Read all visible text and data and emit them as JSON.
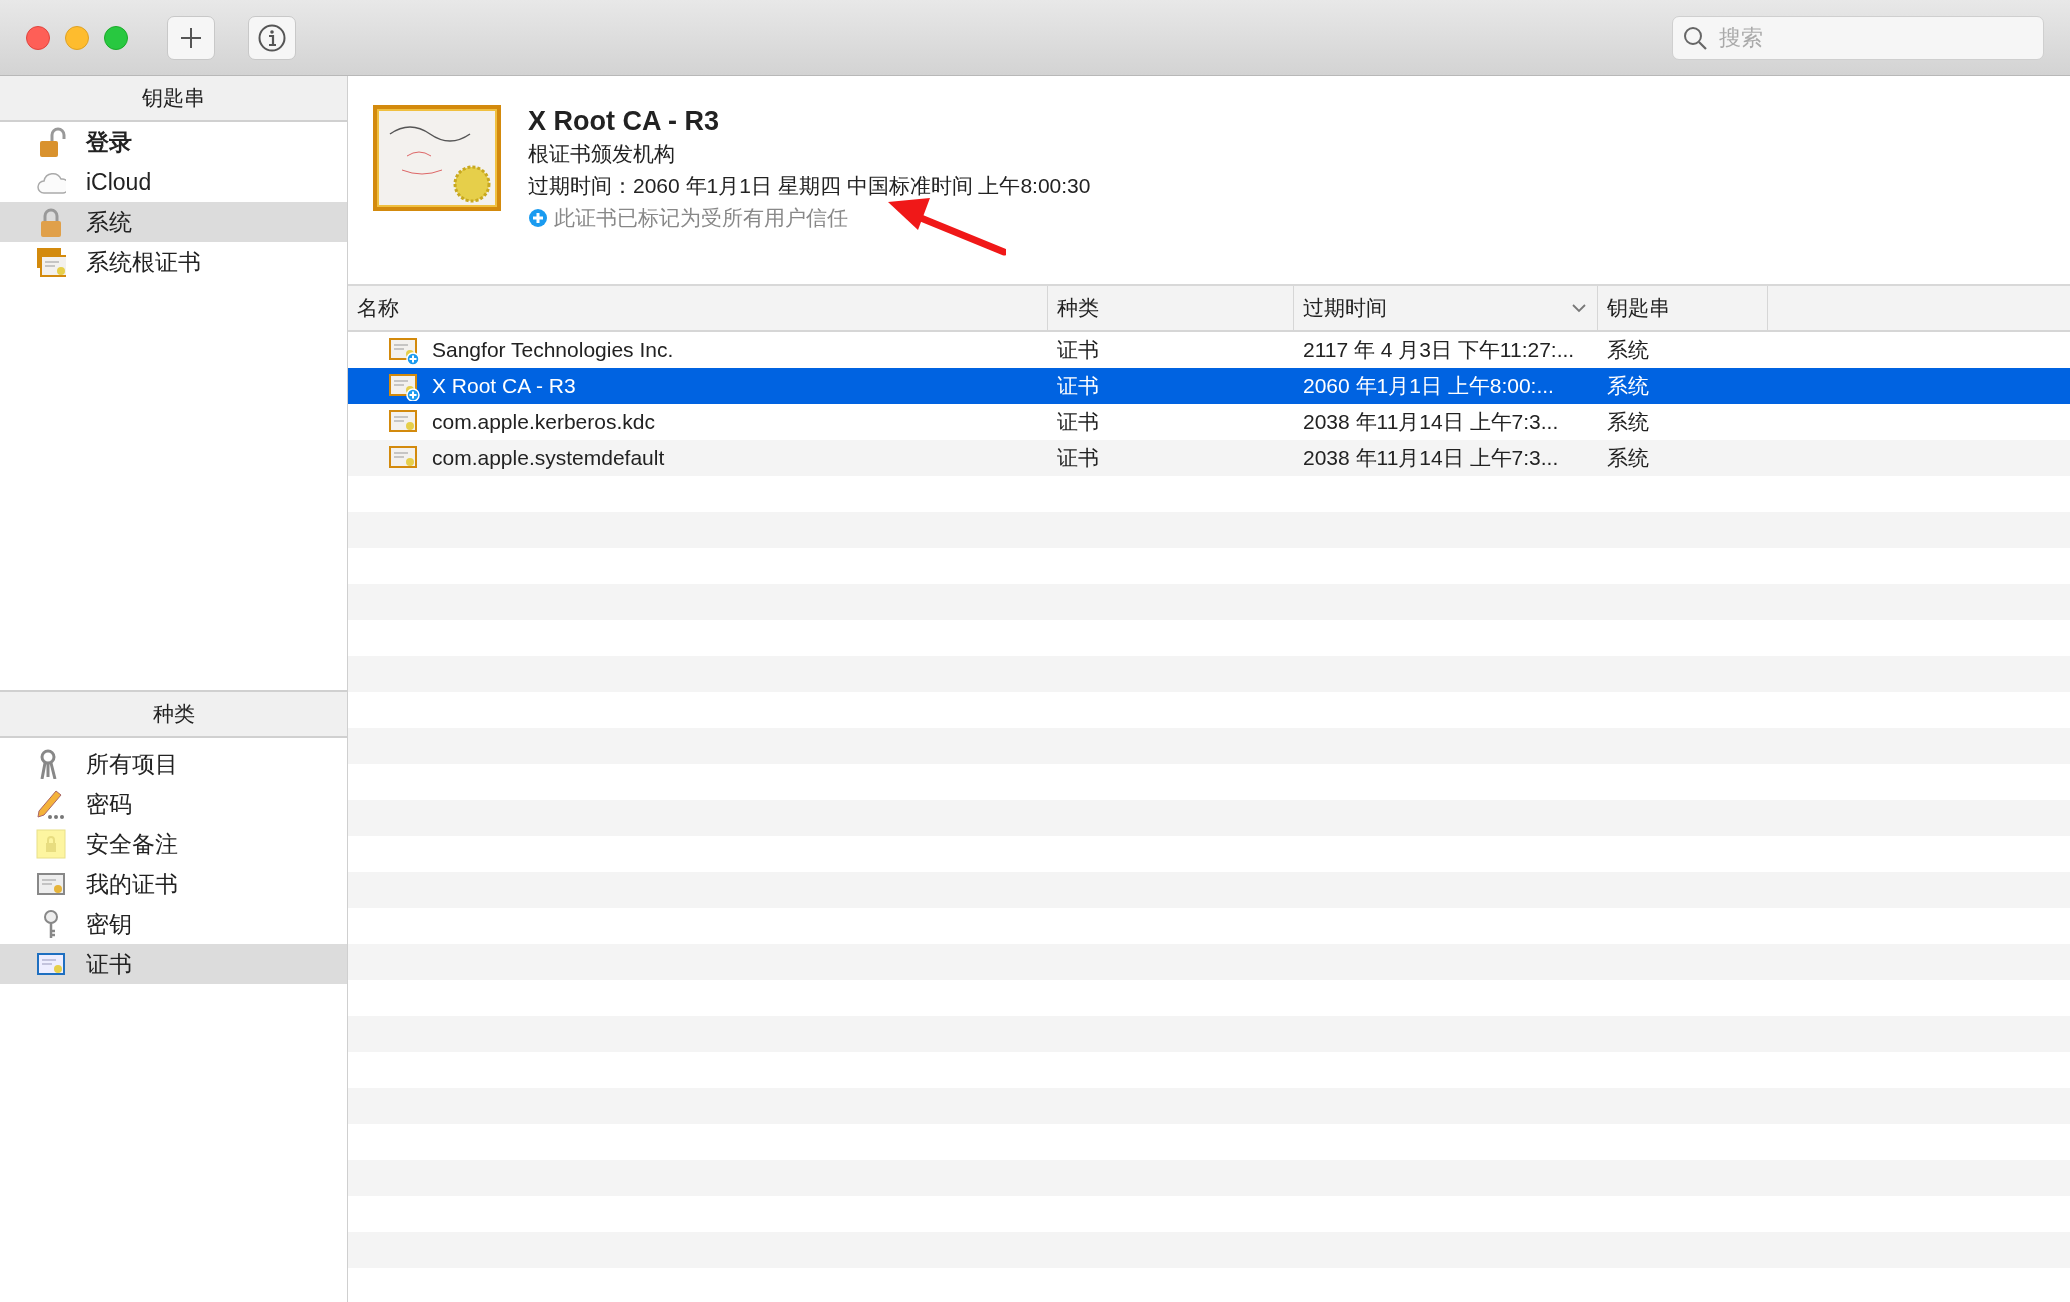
{
  "toolbar": {
    "search": {
      "placeholder": "搜索"
    }
  },
  "keychains": {
    "title": "钥匙串",
    "items": [
      {
        "label": "登录",
        "default": true,
        "selected": false
      },
      {
        "label": "iCloud",
        "default": false,
        "selected": false
      },
      {
        "label": "系统",
        "default": false,
        "selected": true
      },
      {
        "label": "系统根证书",
        "default": false,
        "selected": false
      }
    ]
  },
  "categories": {
    "title": "种类",
    "items": [
      {
        "label": "所有项目",
        "selected": false
      },
      {
        "label": "密码",
        "selected": false
      },
      {
        "label": "安全备注",
        "selected": false
      },
      {
        "label": "我的证书",
        "selected": false
      },
      {
        "label": "密钥",
        "selected": false
      },
      {
        "label": "证书",
        "selected": true
      }
    ]
  },
  "detail": {
    "title": "X Root CA - R3",
    "subtitle": "根证书颁发机构",
    "expiry": "过期时间：2060 年1月1日 星期四 中国标准时间 上午8:00:30",
    "trust": "此证书已标记为受所有用户信任"
  },
  "table": {
    "columns": [
      {
        "label": "名称",
        "sorted": false
      },
      {
        "label": "种类",
        "sorted": false
      },
      {
        "label": "过期时间",
        "sorted": true
      },
      {
        "label": "钥匙串",
        "sorted": false
      }
    ],
    "rows": [
      {
        "name": "Sangfor Technologies Inc.",
        "kind": "证书",
        "expires": "2117 年 4 月3日 下午11:27:...",
        "keychain": "系统",
        "trusted": true,
        "selected": false
      },
      {
        "name": "X Root CA - R3",
        "kind": "证书",
        "expires": "2060 年1月1日 上午8:00:...",
        "keychain": "系统",
        "trusted": true,
        "selected": true
      },
      {
        "name": "com.apple.kerberos.kdc",
        "kind": "证书",
        "expires": "2038 年11月14日 上午7:3...",
        "keychain": "系统",
        "trusted": false,
        "selected": false
      },
      {
        "name": "com.apple.systemdefault",
        "kind": "证书",
        "expires": "2038 年11月14日 上午7:3...",
        "keychain": "系统",
        "trusted": false,
        "selected": false
      }
    ]
  }
}
